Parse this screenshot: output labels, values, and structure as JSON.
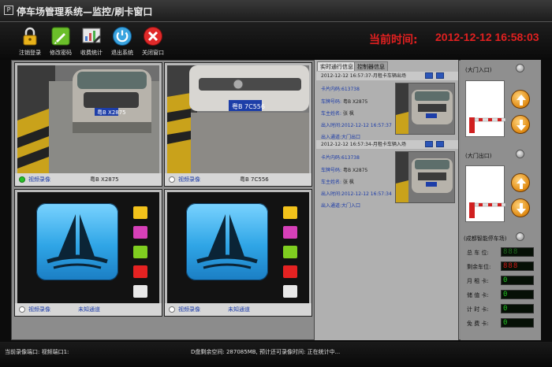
{
  "window": {
    "title": "停车场管理系统—监控/刷卡窗口",
    "icon": "P"
  },
  "toolbar": [
    {
      "label": "注销登录",
      "icon": "lock-icon"
    },
    {
      "label": "修改密码",
      "icon": "edit-icon"
    },
    {
      "label": "收费统计",
      "icon": "chart-icon"
    },
    {
      "label": "退出系统",
      "icon": "power-icon"
    },
    {
      "label": "关闭窗口",
      "icon": "close-icon"
    }
  ],
  "clock": {
    "label": "当前时间:",
    "value": "2012-12-12 16:58:03",
    "color": "#e02020"
  },
  "cameras": [
    {
      "rec": "视频录像",
      "plate": "粤B X2875",
      "active": true
    },
    {
      "rec": "视频录像",
      "plate": "粤B 7C556",
      "active": false
    },
    {
      "rec": "视频录像",
      "channel": "未知通道",
      "active": false
    },
    {
      "rec": "视频录像",
      "channel": "未知通道",
      "active": false
    }
  ],
  "plate_images": [
    "粤B X2875",
    "粤B 7C556"
  ],
  "color_buttons": [
    "#f2c21b",
    "#d640b8",
    "#7fce20",
    "#e52222",
    "#e8e8e8"
  ],
  "info_tabs": [
    "实时通行信息",
    "控制器信息"
  ],
  "records": [
    {
      "header": "2012-12-12 16:57:37-月租卡车辆出场",
      "card": {
        "label": "卡片内码:",
        "value": "613738"
      },
      "plate": {
        "label": "车牌号码:",
        "value": "粤B X2875"
      },
      "owner": {
        "label": "车主姓名:",
        "value": "张 枫"
      },
      "time": {
        "label": "出入时间:",
        "value": "2012-12-12 16:57:37"
      },
      "channel": {
        "label": "出入通道:",
        "value": "大门出口"
      }
    },
    {
      "header": "2012-12-12 16:57:34-月租卡车辆入场",
      "card": {
        "label": "卡片内码:",
        "value": "613738"
      },
      "plate": {
        "label": "车牌号码:",
        "value": "粤B X2875"
      },
      "owner": {
        "label": "车主姓名:",
        "value": "张 枫"
      },
      "time": {
        "label": "出入时间:",
        "value": "2012-12-12 16:57:34"
      },
      "channel": {
        "label": "出入通道:",
        "value": "大门入口"
      }
    }
  ],
  "gates": [
    {
      "label": "(大门入口)"
    },
    {
      "label": "(大门出口)"
    }
  ],
  "stats": {
    "title": "(成都智能停车场)",
    "items": [
      {
        "label": "总 车 位:",
        "value": "888",
        "color": "#1f6b1f"
      },
      {
        "label": "剩余车位:",
        "value": "888",
        "color": "#d01818"
      },
      {
        "label": "月 租 卡:",
        "value": "0",
        "color": "#22c422"
      },
      {
        "label": "储 值 卡:",
        "value": "0",
        "color": "#22c422"
      },
      {
        "label": "计 时 卡:",
        "value": "0",
        "color": "#22c422"
      },
      {
        "label": "免 费 卡:",
        "value": "0",
        "color": "#22c422"
      }
    ]
  },
  "status": {
    "port": "当前录像端口: 视频端口1:",
    "disk": "D盘剩余空间: 287085MB,  预计还可录像时间: 正在统计中..."
  }
}
